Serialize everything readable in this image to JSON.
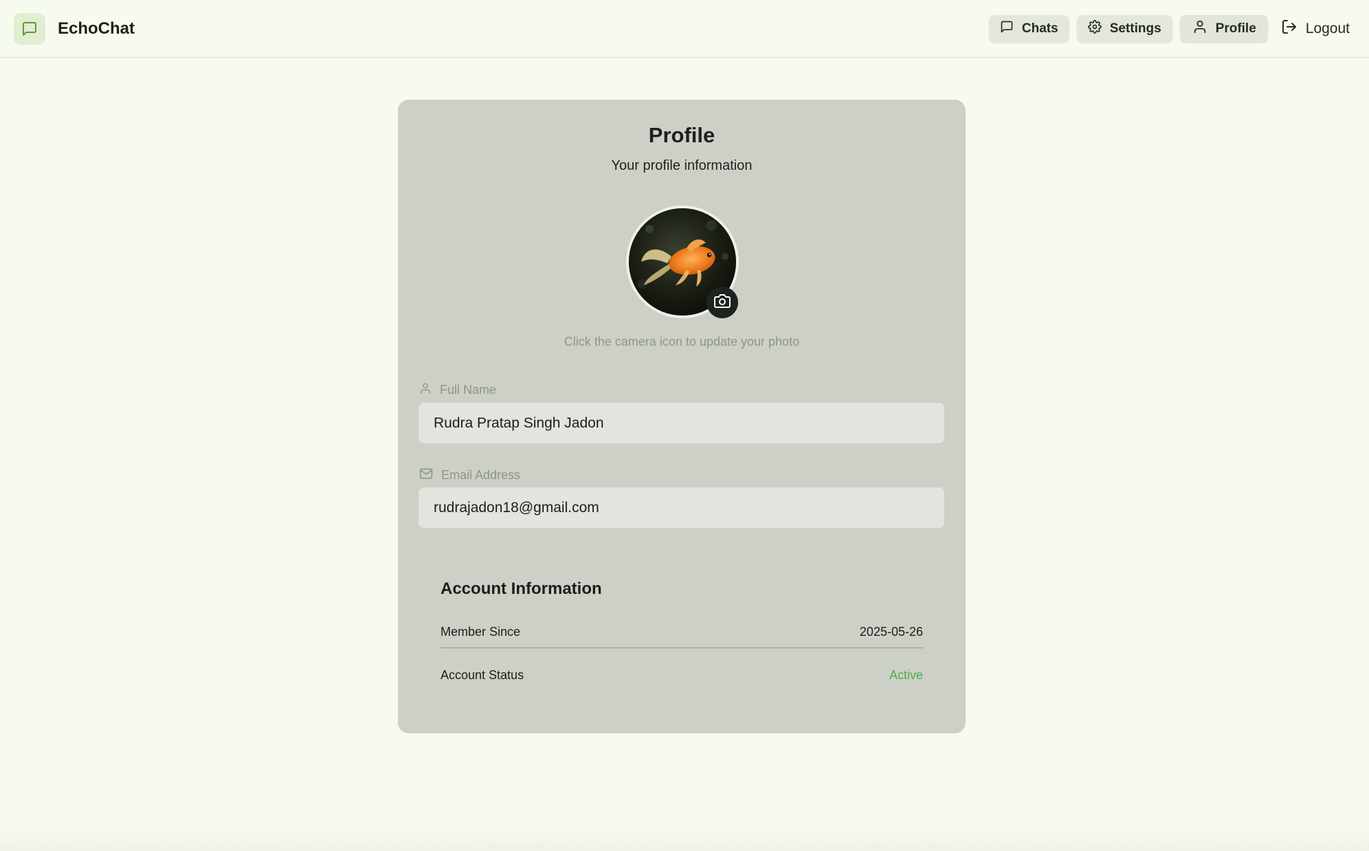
{
  "app": {
    "name": "EchoChat"
  },
  "nav": {
    "chats_label": "Chats",
    "settings_label": "Settings",
    "profile_label": "Profile",
    "logout_label": "Logout"
  },
  "profile": {
    "title": "Profile",
    "subtitle": "Your profile information",
    "photo_hint": "Click the camera icon to update your photo",
    "full_name_label": "Full Name",
    "full_name_value": "Rudra Pratap Singh Jadon",
    "email_label": "Email Address",
    "email_value": "rudrajadon18@gmail.com"
  },
  "account": {
    "title": "Account Information",
    "member_since_label": "Member Since",
    "member_since_value": "2025-05-26",
    "status_label": "Account Status",
    "status_value": "Active"
  },
  "colors": {
    "page_bg": "#f7fbef",
    "card_bg": "#cdd0c6",
    "input_bg": "#e2e4dd",
    "accent_green": "#4caf50",
    "logo_bg": "#e2edd2"
  },
  "icons": {
    "logo": "message-square-icon",
    "chats": "message-square-icon",
    "settings": "gear-icon",
    "profile": "user-icon",
    "logout": "logout-icon",
    "camera": "camera-icon",
    "full_name": "user-icon",
    "email": "mail-icon"
  }
}
